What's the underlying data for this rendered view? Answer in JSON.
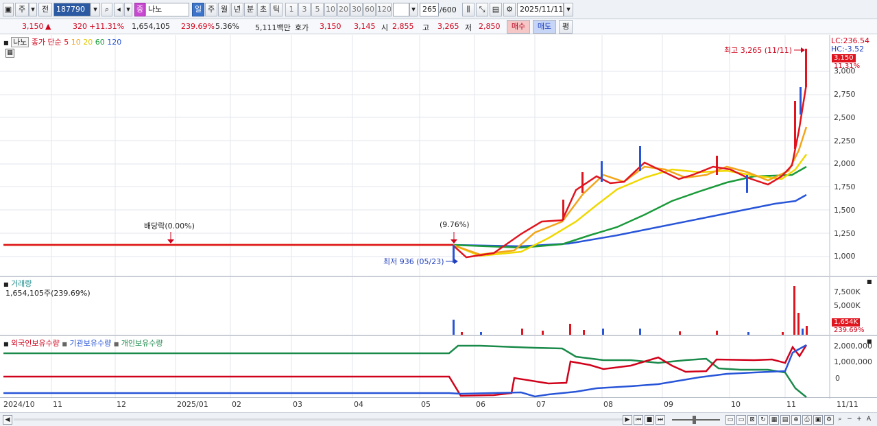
{
  "toolbar": {
    "market_btn": "주",
    "prev_btn": "전",
    "code": "187790",
    "name_badge": "중",
    "name": "나노",
    "periods": [
      "일",
      "주",
      "월",
      "년",
      "분",
      "초",
      "틱"
    ],
    "intervals": [
      "1",
      "3",
      "5",
      "10",
      "20",
      "30",
      "60",
      "120"
    ],
    "count": "265",
    "max_count": "/600",
    "date": "2025/11/11"
  },
  "quote": {
    "price": "3,150",
    "arrow": "▲",
    "change": "320",
    "change_pct": "+11.31%",
    "volume": "1,654,105",
    "volume_ratio": "239.69%",
    "turnover": "5.36%",
    "amount": "5,111백만",
    "ask_label": "호가",
    "ask": "3,150",
    "bid": "3,145",
    "open_label": "시",
    "open": "2,855",
    "high_label": "고",
    "high": "3,265",
    "low_label": "저",
    "low": "2,850",
    "buy_label": "매수",
    "sell_label": "매도",
    "eval_label": "평"
  },
  "price_pane": {
    "name": "나노",
    "ma_label": "종가 단순",
    "ma_periods": [
      {
        "label": "5",
        "color": "#e0141e"
      },
      {
        "label": "10",
        "color": "#f2a51a"
      },
      {
        "label": "20",
        "color": "#f0d800"
      },
      {
        "label": "60",
        "color": "#1a9a3a"
      },
      {
        "label": "120",
        "color": "#2855d8"
      }
    ],
    "lc": "LC:236.54",
    "hc": "HC:-3.52",
    "price_tag": "3,150",
    "pct_tag": "11.31%",
    "high_note": "최고 3,265 (11/11)",
    "low_note": "최저 936 (05/23)",
    "dividend_note": "배당락(0.00%)",
    "dividend_note2": "(9.76%)",
    "y_ticks": [
      "3,000",
      "2,750",
      "2,500",
      "2,250",
      "2,000",
      "1,750",
      "1,500",
      "1,250",
      "1,000"
    ]
  },
  "volume_pane": {
    "title": "거래량",
    "value": "1,654,105주(239.69%)",
    "y_ticks": [
      "7,500K",
      "5,000K"
    ],
    "vol_tag": "1,654K",
    "vol_pct": "239.69%"
  },
  "holding_pane": {
    "legend": [
      {
        "label": "외국인보유수량",
        "color": "#d0021b"
      },
      {
        "label": "기관보유수량",
        "color": "#2855d8"
      },
      {
        "label": "개인보유수량",
        "color": "#1a8a4a"
      }
    ],
    "y_ticks": [
      "2,000,000",
      "1,000,000",
      "0"
    ]
  },
  "x_axis": [
    "2024/10",
    "11",
    "12",
    "2025/01",
    "02",
    "03",
    "04",
    "05",
    "06",
    "07",
    "08",
    "09",
    "10",
    "11",
    "11/11"
  ],
  "colors": {
    "up": "#e0141e",
    "down": "#2855d8",
    "accent": "#3b74c9"
  }
}
